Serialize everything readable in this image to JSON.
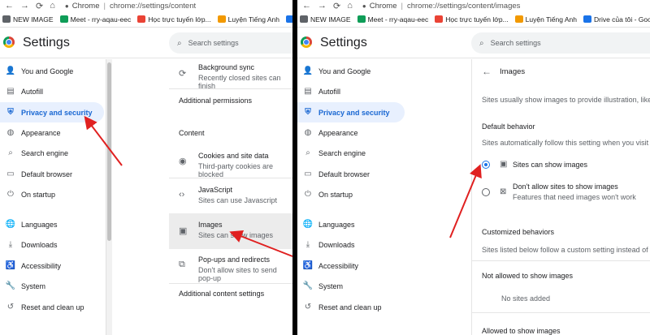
{
  "browser": {
    "brand": "Chrome",
    "left_url": "chrome://settings/content",
    "right_url": "chrome://settings/content/images"
  },
  "bookmarks": [
    {
      "label": "NEW IMAGE",
      "color": "#5f6368"
    },
    {
      "label": "Meet - rry-aqau-eec",
      "color": "#0f9d58"
    },
    {
      "label": "Học trực tuyến lớp...",
      "color": "#ea4335"
    },
    {
      "label": "Luyện Tiếng Anh",
      "color": "#f29900"
    },
    {
      "label": "Drive của tôi - Goo...",
      "color": "#1a73e8"
    }
  ],
  "header": {
    "title": "Settings",
    "search_placeholder": "Search settings"
  },
  "sidebar": {
    "items": [
      {
        "label": "You and Google",
        "icon": "person-icon"
      },
      {
        "label": "Autofill",
        "icon": "autofill-icon"
      },
      {
        "label": "Privacy and security",
        "icon": "shield-icon"
      },
      {
        "label": "Appearance",
        "icon": "palette-icon"
      },
      {
        "label": "Search engine",
        "icon": "search-icon"
      },
      {
        "label": "Default browser",
        "icon": "browser-icon"
      },
      {
        "label": "On startup",
        "icon": "power-icon"
      },
      {
        "label": "Languages",
        "icon": "globe-icon"
      },
      {
        "label": "Downloads",
        "icon": "download-icon"
      },
      {
        "label": "Accessibility",
        "icon": "accessibility-icon"
      },
      {
        "label": "System",
        "icon": "wrench-icon"
      },
      {
        "label": "Reset and clean up",
        "icon": "reset-icon"
      }
    ]
  },
  "left_content": {
    "background_sync_title": "Background sync",
    "background_sync_desc": "Recently closed sites can finish",
    "additional_permissions": "Additional permissions",
    "content_heading": "Content",
    "cookies_title": "Cookies and site data",
    "cookies_desc": "Third-party cookies are blocked",
    "javascript_title": "JavaScript",
    "javascript_desc": "Sites can use Javascript",
    "images_title": "Images",
    "images_desc": "Sites can show images",
    "popups_title": "Pop-ups and redirects",
    "popups_desc": "Don't allow sites to send pop-up",
    "additional_content": "Additional content settings"
  },
  "right_content": {
    "page_title": "Images",
    "intro": "Sites usually show images to provide illustration, like",
    "default_behavior": "Default behavior",
    "default_desc": "Sites automatically follow this setting when you visit t",
    "option_allow": "Sites can show images",
    "option_block_title": "Don't allow sites to show images",
    "option_block_desc": "Features that need images won't work",
    "customized_behaviors": "Customized behaviors",
    "customized_desc": "Sites listed below follow a custom setting instead of",
    "not_allowed": "Not allowed to show images",
    "no_sites": "No sites added",
    "allowed": "Allowed to show images"
  },
  "colors": {
    "accent": "#1a73e8",
    "active_bg": "#e8f0fe",
    "annotation_arrow": "#e02020"
  }
}
